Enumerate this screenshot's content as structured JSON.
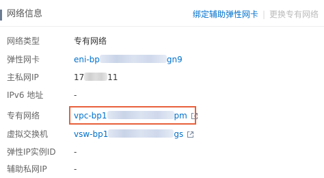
{
  "section": {
    "title": "网络信息",
    "actions": {
      "bind_eni": "绑定辅助弹性网卡",
      "change_vpc": "更换专有网络"
    }
  },
  "rows": {
    "network_type": {
      "label": "网络类型",
      "value": "专有网络"
    },
    "eni": {
      "label": "弹性网卡",
      "value_prefix": "eni-bp",
      "value_suffix": "gn9"
    },
    "private_ip": {
      "label": "主私网IP",
      "value_prefix": "17",
      "value_suffix": "11"
    },
    "ipv6": {
      "label": "IPv6 地址",
      "value": "-"
    },
    "vpc": {
      "label": "专有网络",
      "value_prefix": "vpc-bp1",
      "value_suffix": "pm"
    },
    "vswitch": {
      "label": "虚拟交换机",
      "value_prefix": "vsw-bp1",
      "value_suffix": "gs"
    },
    "eip": {
      "label": "弹性IP实例ID",
      "value": "-"
    },
    "secondary_ip": {
      "label": "辅助私网IP",
      "value": "-"
    }
  },
  "colors": {
    "link": "#0070cc",
    "highlight_border": "#e85f3a"
  },
  "icons": [
    "external-link-icon"
  ]
}
